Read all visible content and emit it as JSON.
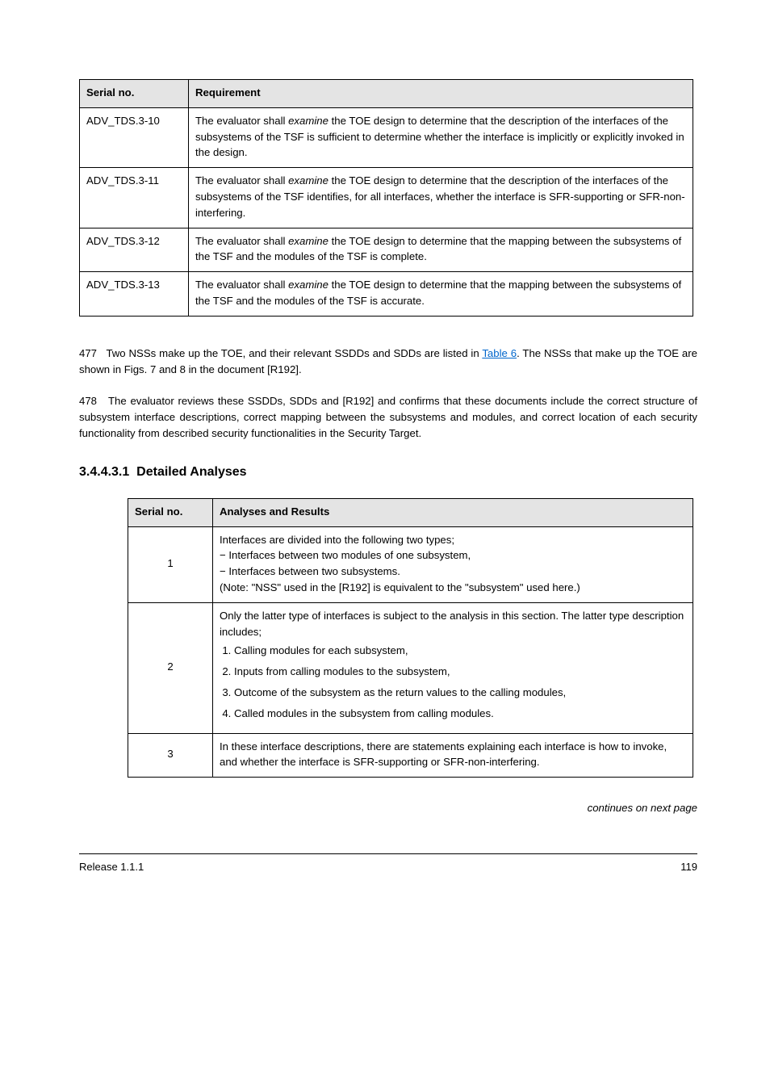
{
  "table1": {
    "headers": {
      "c1": "Serial no.",
      "c2": "Requirement"
    },
    "rows": [
      {
        "c1": "ADV_TDS.3-10",
        "c2_pre": "The evaluator shall ",
        "c2_em": "examine",
        "c2_post": " the TOE design to determine that the description of the interfaces of the subsystems of the TSF is sufficient to determine whether the interface is implicitly or explicitly invoked in the design."
      },
      {
        "c1": "ADV_TDS.3-11",
        "c2_pre": "The evaluator shall ",
        "c2_em": "examine",
        "c2_post": " the TOE design to determine that the description of the interfaces of the subsystems of the TSF identifies, for all interfaces, whether the interface is SFR-supporting or SFR-non-interfering."
      },
      {
        "c1": "ADV_TDS.3-12",
        "c2_pre": "The evaluator shall ",
        "c2_em": "examine",
        "c2_post": " the TOE design to determine that the mapping between the subsystems of the TSF and the modules of the TSF is complete."
      },
      {
        "c1": "ADV_TDS.3-13",
        "c2_pre": "The evaluator shall ",
        "c2_em": "examine",
        "c2_post": " the TOE design to determine that the mapping between the subsystems of the TSF and the modules of the TSF is accurate."
      }
    ]
  },
  "paragraphs": {
    "p1_no": "477",
    "p1_text_pre": "Two NSSs make up the TOE, and their relevant SSDDs and SDDs are listed in ",
    "p1_link": "Table 6",
    "p1_text_post": ". The NSSs that make up the TOE are shown in Figs. 7 and 8 in the document [R192].",
    "p2_no": "478",
    "p2_text": "The evaluator reviews these SSDDs, SDDs and [R192] and confirms that these documents include the correct structure of subsystem interface descriptions, correct mapping between the subsystems and modules, and correct location of each security functionality from described security functionalities in the Security Target."
  },
  "section": {
    "num": "3.4.4.3.1",
    "title": "Detailed Analyses"
  },
  "table2": {
    "headers": {
      "c1": "Serial no.",
      "c2": "Analyses and Results"
    },
    "rows": [
      {
        "c1": "1",
        "content_type": "plain",
        "c2_lines": [
          "Interfaces are divided into the following two types;",
          "− Interfaces between two modules of one subsystem,",
          "− Interfaces between two subsystems.",
          "(Note: \"NSS\" used in the [R192] is equivalent to the \"subsystem\" used here.)"
        ]
      },
      {
        "c1": "2",
        "content_type": "ordered",
        "intro": "Only the latter type of interfaces is subject to the analysis in this section. The latter type description includes;",
        "items": [
          "Calling modules for each subsystem,",
          "Inputs from calling modules to the subsystem,",
          "Outcome of the subsystem as the return values to the calling modules,",
          "Called modules in the subsystem from calling modules."
        ]
      },
      {
        "c1": "3",
        "content_type": "plain",
        "c2_lines": [
          "In these interface descriptions, there are statements explaining each interface is how to invoke, and whether the interface is SFR-supporting or SFR-non-interfering."
        ]
      }
    ]
  },
  "footer": {
    "cont": "continues on next page",
    "left": "Release 1.1.1",
    "right": "119"
  }
}
